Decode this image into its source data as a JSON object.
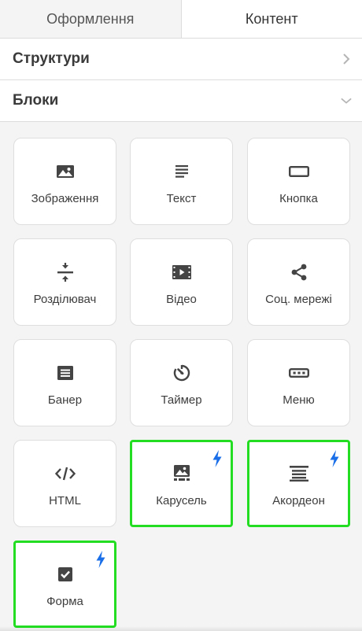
{
  "tabs": [
    {
      "label": "Оформлення",
      "active": false
    },
    {
      "label": "Контент",
      "active": true
    }
  ],
  "sections": {
    "structures": {
      "title": "Структури",
      "state": "collapsed"
    },
    "blocks": {
      "title": "Блоки",
      "state": "expanded"
    }
  },
  "blocks": [
    {
      "label": "Зображення",
      "icon": "image-icon"
    },
    {
      "label": "Текст",
      "icon": "text-icon"
    },
    {
      "label": "Кнопка",
      "icon": "button-icon"
    },
    {
      "label": "Розділювач",
      "icon": "divider-icon"
    },
    {
      "label": "Відео",
      "icon": "video-icon"
    },
    {
      "label": "Соц. мережі",
      "icon": "share-icon"
    },
    {
      "label": "Банер",
      "icon": "banner-icon"
    },
    {
      "label": "Таймер",
      "icon": "timer-icon"
    },
    {
      "label": "Меню",
      "icon": "menu-icon"
    },
    {
      "label": "HTML",
      "icon": "code-icon"
    },
    {
      "label": "Карусель",
      "icon": "carousel-icon",
      "highlighted": true,
      "premium": true
    },
    {
      "label": "Акордеон",
      "icon": "accordion-icon",
      "highlighted": true,
      "premium": true
    },
    {
      "label": "Форма",
      "icon": "form-checkbox-icon",
      "highlighted": true,
      "premium": true
    }
  ],
  "colors": {
    "highlight": "#22dd22",
    "bolt": "#1a6fe8",
    "icon": "#444444"
  }
}
